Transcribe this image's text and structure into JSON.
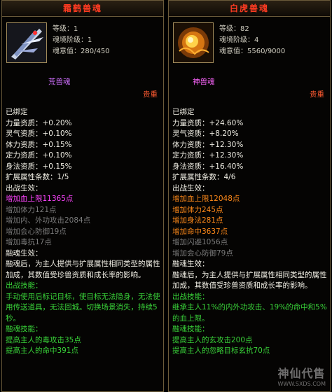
{
  "left": {
    "title": "霜鹤兽魂",
    "level": "等级：1",
    "realm": "魂境阶级：1",
    "soul": "魂意值：280/450",
    "tier": "荒兽魂",
    "rarity": "贵重",
    "lines": [
      {
        "t": "已绑定",
        "c": "w"
      },
      {
        "t": "力量资质：+0.20%",
        "c": "w"
      },
      {
        "t": "灵气资质：+0.10%",
        "c": "w"
      },
      {
        "t": "体力资质：+0.15%",
        "c": "w"
      },
      {
        "t": "定力资质：+0.10%",
        "c": "w"
      },
      {
        "t": "身法资质：+0.15%",
        "c": "w"
      },
      {
        "t": "扩展属性条数：1/5",
        "c": "w"
      },
      {
        "t": "出战生效：",
        "c": "w"
      },
      {
        "t": "增加血上限11365点",
        "c": "pink"
      },
      {
        "t": "增加体力121点",
        "c": "gray"
      },
      {
        "t": "增加内、外功攻击2084点",
        "c": "gray"
      },
      {
        "t": "增加会心防御19点",
        "c": "gray"
      },
      {
        "t": "增加毒抗17点",
        "c": "gray"
      },
      {
        "t": "融魂生效：",
        "c": "w"
      },
      {
        "t": "融魂后，为主人提供与扩展属性相同类型的属性加成，其数值受珍兽资质和成长率的影响。",
        "c": "w",
        "wrap": true
      },
      {
        "t": "出战技能：",
        "c": "green"
      },
      {
        "t": "手动使用后标记目标，使目标无法隐身，无法使用传送道具，无法回城。切换场景消失，持续5秒。",
        "c": "green",
        "wrap": true
      },
      {
        "t": "融魂技能：",
        "c": "green"
      },
      {
        "t": "提高主人的毒攻击35点",
        "c": "green"
      },
      {
        "t": "提高主人的命中391点",
        "c": "green"
      }
    ]
  },
  "right": {
    "title": "白虎兽魂",
    "level": "等级：82",
    "realm": "魂境阶级：4",
    "soul": "魂意值：5560/9000",
    "tier": "神兽魂",
    "rarity": "贵重",
    "lines": [
      {
        "t": "已绑定",
        "c": "w"
      },
      {
        "t": "力量资质：+24.60%",
        "c": "w"
      },
      {
        "t": "灵气资质：+8.20%",
        "c": "w"
      },
      {
        "t": "体力资质：+12.30%",
        "c": "w"
      },
      {
        "t": "定力资质：+12.30%",
        "c": "w"
      },
      {
        "t": "身法资质：+16.40%",
        "c": "w"
      },
      {
        "t": "扩展属性条数：4/6",
        "c": "w"
      },
      {
        "t": "出战生效：",
        "c": "w"
      },
      {
        "t": "增加血上限12048点",
        "c": "orange"
      },
      {
        "t": "增加体力245点",
        "c": "orange"
      },
      {
        "t": "增加身法281点",
        "c": "orange"
      },
      {
        "t": "增加命中3637点",
        "c": "orange"
      },
      {
        "t": "增加闪避1056点",
        "c": "gray"
      },
      {
        "t": "增加会心防御79点",
        "c": "gray"
      },
      {
        "t": "融魂生效：",
        "c": "w"
      },
      {
        "t": "融魂后，为主人提供与扩展属性相同类型的属性加成，其数值受珍兽资质和成长率的影响。",
        "c": "w",
        "wrap": true
      },
      {
        "t": "出战技能：",
        "c": "green"
      },
      {
        "t": "继承主人11%的内外功攻击、19%的命中和5%的血上限。",
        "c": "green",
        "wrap": true
      },
      {
        "t": "融魂技能：",
        "c": "green"
      },
      {
        "t": "提高主人的玄攻击200点",
        "c": "green"
      },
      {
        "t": "提高主人的忽略目标玄抗70点",
        "c": "green"
      }
    ]
  },
  "watermark": {
    "main": "神仙代售",
    "sub": "WWW.SXDS.COM"
  },
  "colors": {
    "tier_left": "#d070ff",
    "tier_right": "#ff66ff",
    "rarity": "#ff5a30"
  }
}
